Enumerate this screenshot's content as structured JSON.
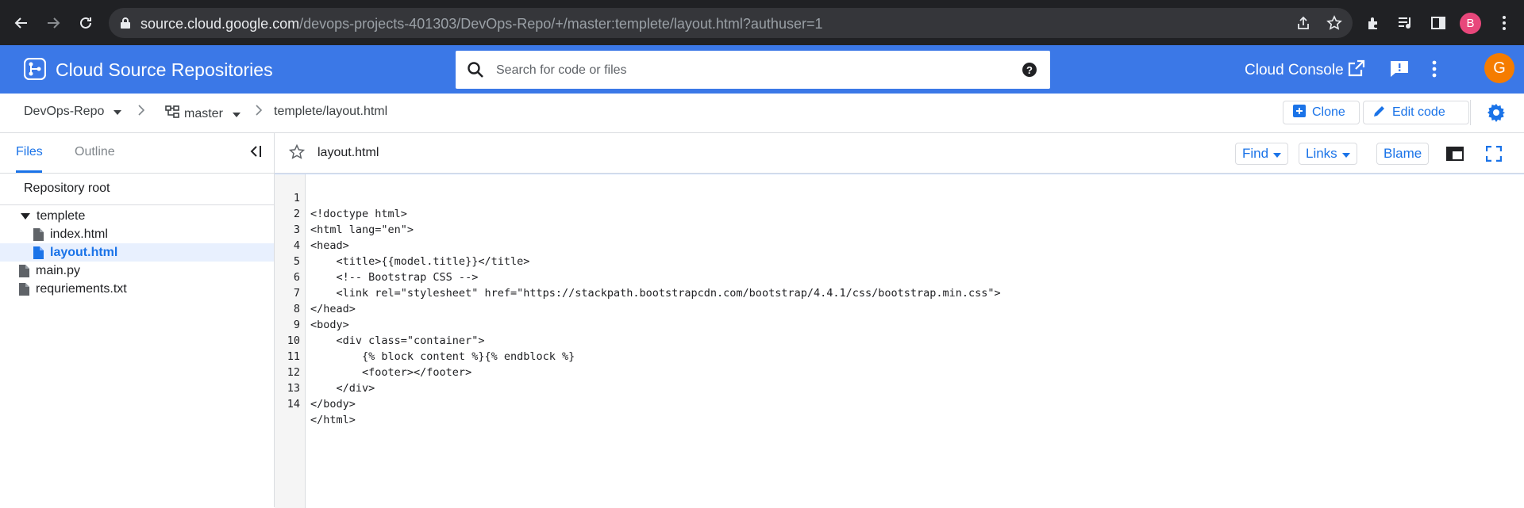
{
  "browser": {
    "url_host": "source.cloud.google.com",
    "url_path": "/devops-projects-401303/DevOps-Repo/+/master:templete/layout.html?authuser=1",
    "profile_initial": "B",
    "profile_color": "#e8477b",
    "icons": [
      "back-arrow-icon",
      "forward-arrow-icon",
      "reload-icon",
      "lock-icon",
      "share-icon",
      "bookmark-star-icon",
      "extensions-icon",
      "media-queue-icon",
      "side-panel-icon",
      "more-vert-icon"
    ]
  },
  "header": {
    "title": "Cloud Source Repositories",
    "search_placeholder": "Search for code or files",
    "console_label": "Cloud Console",
    "avatar_initial": "G",
    "brand_color": "#3b78e7",
    "avatar_color": "#f57c00"
  },
  "breadcrumb": {
    "repo": "DevOps-Repo",
    "branch": "master",
    "path": "templete/layout.html",
    "clone_label": "Clone",
    "edit_label": "Edit code"
  },
  "sidebar": {
    "tabs": [
      "Files",
      "Outline"
    ],
    "active_tab": "Files",
    "root_label": "Repository root",
    "tree": [
      {
        "label": "templete",
        "type": "folder",
        "expanded": true
      },
      {
        "label": "index.html",
        "type": "file"
      },
      {
        "label": "layout.html",
        "type": "file",
        "selected": true
      },
      {
        "label": "main.py",
        "type": "file"
      },
      {
        "label": "requriements.txt",
        "type": "file"
      }
    ]
  },
  "editor": {
    "filename": "layout.html",
    "find_label": "Find",
    "links_label": "Links",
    "blame_label": "Blame",
    "lines": [
      "<!doctype html>",
      "<html lang=\"en\">",
      "<head>",
      "    <title>{{model.title}}</title>",
      "    <!-- Bootstrap CSS -->",
      "    <link rel=\"stylesheet\" href=\"https://stackpath.bootstrapcdn.com/bootstrap/4.4.1/css/bootstrap.min.css\">",
      "</head>",
      "<body>",
      "    <div class=\"container\">",
      "        {% block content %}{% endblock %}",
      "        <footer></footer>",
      "    </div>",
      "</body>",
      "</html>"
    ],
    "line_numbers": [
      "1",
      "2",
      "3",
      "4",
      "5",
      "6",
      "7",
      "8",
      "9",
      "10",
      "11",
      "12",
      "13",
      "14"
    ]
  }
}
